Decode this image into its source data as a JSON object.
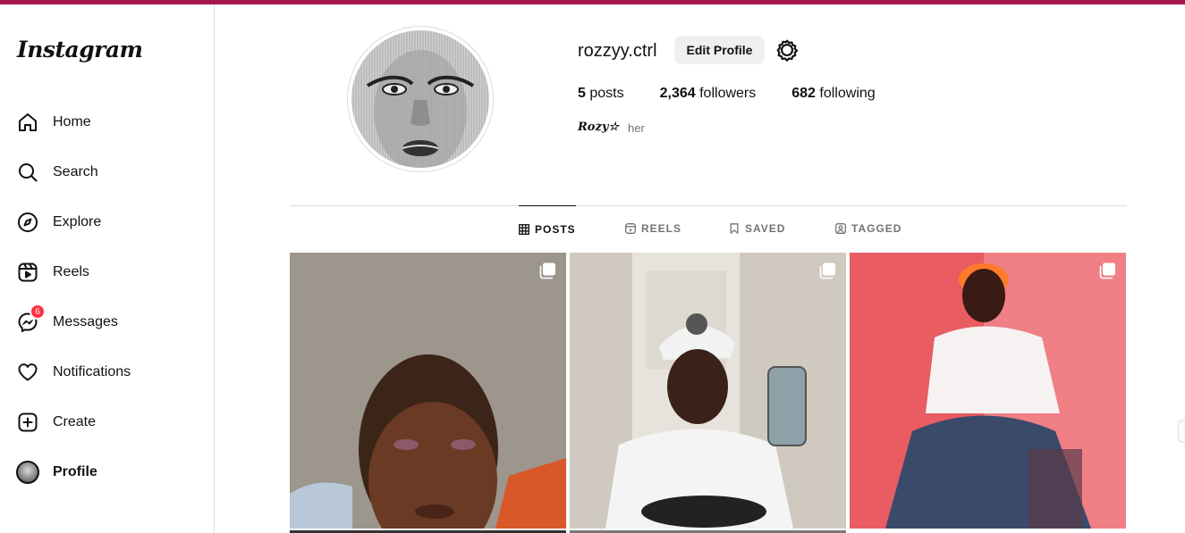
{
  "app": {
    "logo": "Instagram"
  },
  "sidebar": {
    "items": [
      {
        "label": "Home",
        "icon": "home-icon"
      },
      {
        "label": "Search",
        "icon": "search-icon"
      },
      {
        "label": "Explore",
        "icon": "compass-icon"
      },
      {
        "label": "Reels",
        "icon": "reels-icon"
      },
      {
        "label": "Messages",
        "icon": "messenger-icon",
        "badge": "6"
      },
      {
        "label": "Notifications",
        "icon": "heart-icon"
      },
      {
        "label": "Create",
        "icon": "plus-square-icon"
      },
      {
        "label": "Profile",
        "icon": "avatar",
        "active": true
      }
    ]
  },
  "profile": {
    "username": "rozzyy.ctrl",
    "edit_label": "Edit Profile",
    "stats": {
      "posts_count": "5",
      "posts_label": "posts",
      "followers_count": "2,364",
      "followers_label": "followers",
      "following_count": "682",
      "following_label": "following"
    },
    "bio_name": "Rozy☆",
    "pronouns": "her"
  },
  "tabs": [
    {
      "label": "POSTS",
      "icon": "grid-icon",
      "active": true
    },
    {
      "label": "REELS",
      "icon": "reels-icon"
    },
    {
      "label": "SAVED",
      "icon": "bookmark-icon"
    },
    {
      "label": "TAGGED",
      "icon": "tag-person-icon"
    }
  ],
  "colors": {
    "accent_bar": "#a3174d",
    "badge": "#ff3040"
  }
}
